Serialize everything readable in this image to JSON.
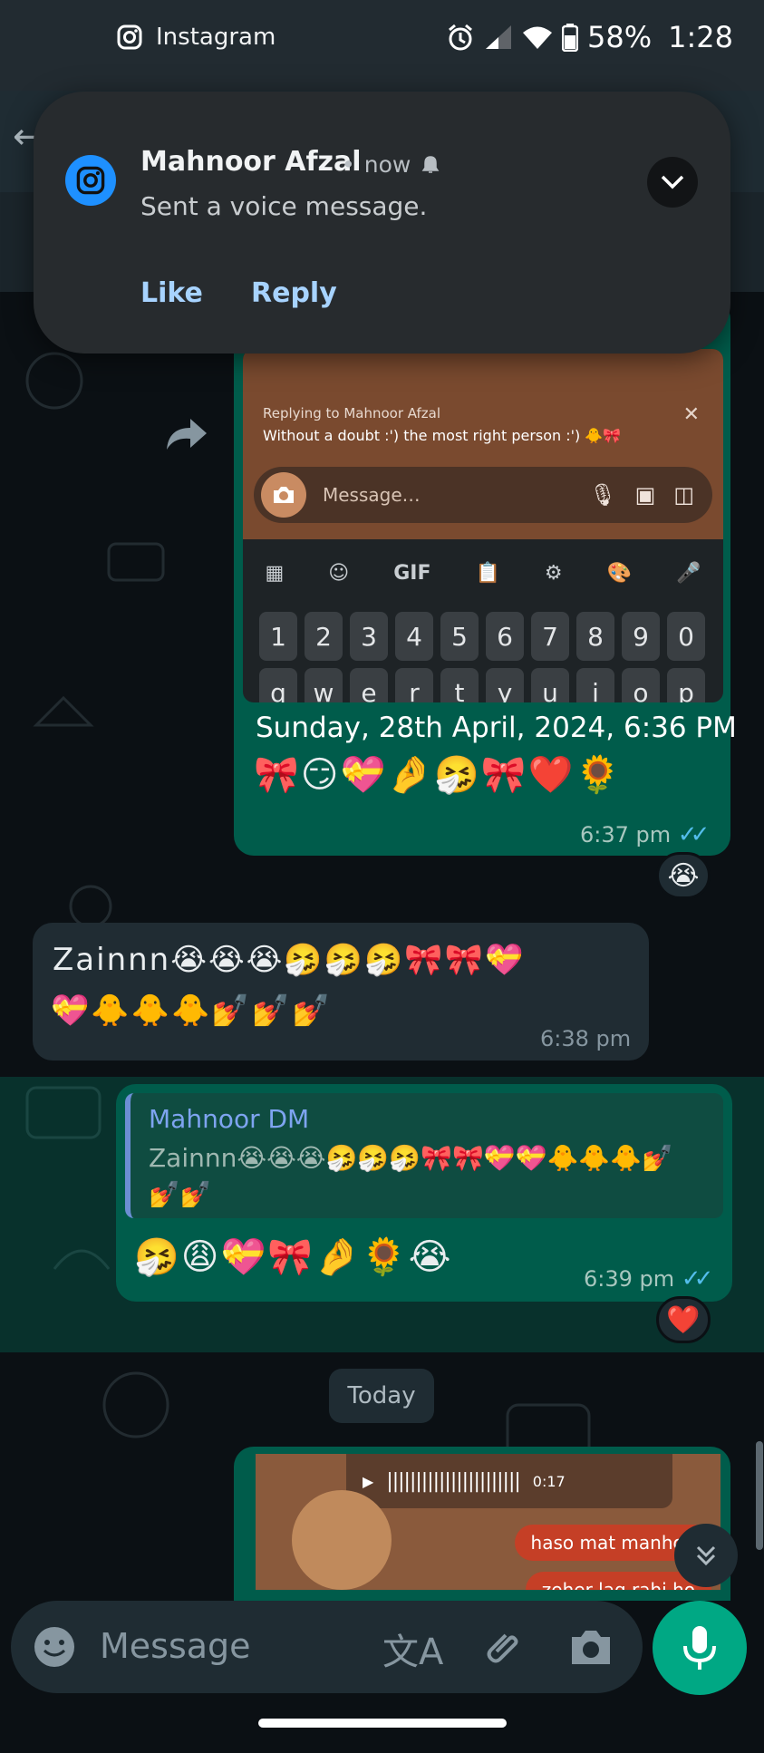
{
  "statusbar": {
    "app_name": "Instagram",
    "battery": "58%",
    "time": "1:28"
  },
  "notification": {
    "sender": "Mahnoor Afzal",
    "when": "now",
    "body": "Sent a voice message.",
    "actions": [
      "Like",
      "Reply"
    ]
  },
  "screenshot_msg": {
    "replying_to": "Replying to Mahnoor Afzal",
    "reply_text": "Without a doubt :') the most right person :') 🐥🎀",
    "input_placeholder": "Message…",
    "toolbar_gif": "GIF",
    "keys_row1": [
      "1",
      "2",
      "3",
      "4",
      "5",
      "6",
      "7",
      "8",
      "9",
      "0"
    ],
    "keys_row2": [
      "q",
      "w",
      "e",
      "r",
      "t",
      "y",
      "u",
      "i",
      "o",
      "p"
    ],
    "caption_date": "Sunday, 28th April, 2024, 6:36 PM",
    "caption_emojis": "🎀😏💝🤌🤧🎀❤️🌻",
    "time": "6:37 pm",
    "reaction": "😭"
  },
  "incoming_msg": {
    "line1": "Zainnn😭😭😭🤧🤧🤧🎀🎀💝",
    "line2": "💝🐥🐥🐥💅💅💅",
    "time": "6:38 pm"
  },
  "reply_msg": {
    "quoted_author": "Mahnoor DM",
    "quoted_text": "Zainnn😭😭😭🤧🤧🤧🎀🎀💝💝🐥🐥🐥💅💅💅",
    "text": "🤧😩💝🎀🤌🌻😭",
    "time": "6:39 pm",
    "reaction": "❤️"
  },
  "date_chip": "Today",
  "voice_clip": {
    "duration": "0:17",
    "chip1": "haso mat manhoo",
    "chip2": "zeher lag rahi ho"
  },
  "composer": {
    "placeholder": "Message"
  },
  "colors": {
    "outgoing_bubble": "#005c4b",
    "incoming_bubble": "#202c33",
    "accent": "#00a884",
    "read_ticks": "#53bdeb"
  }
}
